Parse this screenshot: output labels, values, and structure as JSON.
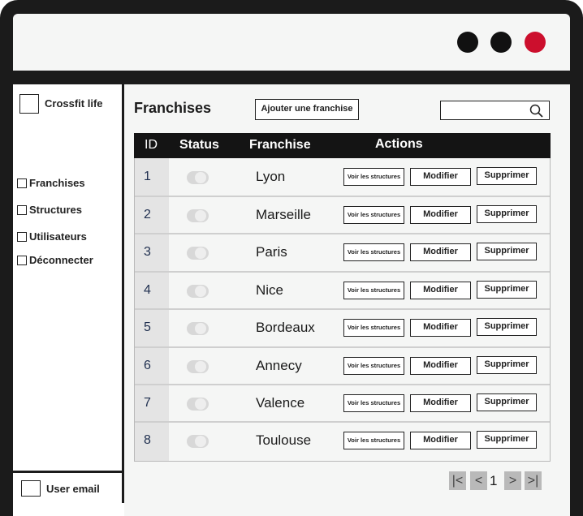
{
  "window": {
    "dots": [
      "#111111",
      "#111111",
      "#cc0f2d"
    ]
  },
  "sidebar": {
    "app_title": "Crossfit life",
    "items": [
      {
        "label": "Franchises"
      },
      {
        "label": "Structures"
      },
      {
        "label": "Utilisateurs"
      },
      {
        "label": "Déconnecter"
      }
    ],
    "user_label": "User email"
  },
  "main": {
    "title": "Franchises",
    "add_button": "Ajouter une franchise",
    "search_placeholder": ""
  },
  "table": {
    "headers": {
      "id": "ID",
      "status": "Status",
      "franchise": "Franchise",
      "actions": "Actions"
    },
    "action_labels": {
      "view": "Voir les structures",
      "edit": "Modifier",
      "delete": "Supprimer"
    },
    "rows": [
      {
        "id": "1",
        "name": "Lyon",
        "status": "inactive"
      },
      {
        "id": "2",
        "name": "Marseille",
        "status": "inactive"
      },
      {
        "id": "3",
        "name": "Paris",
        "status": "inactive"
      },
      {
        "id": "4",
        "name": "Nice",
        "status": "inactive"
      },
      {
        "id": "5",
        "name": "Bordeaux",
        "status": "inactive"
      },
      {
        "id": "6",
        "name": "Annecy",
        "status": "inactive"
      },
      {
        "id": "7",
        "name": "Valence",
        "status": "inactive"
      },
      {
        "id": "8",
        "name": "Toulouse",
        "status": "inactive"
      }
    ]
  },
  "pagination": {
    "current_page": "1",
    "icons": [
      "first-page-icon",
      "prev-page-icon",
      "next-page-icon",
      "last-page-icon"
    ]
  }
}
